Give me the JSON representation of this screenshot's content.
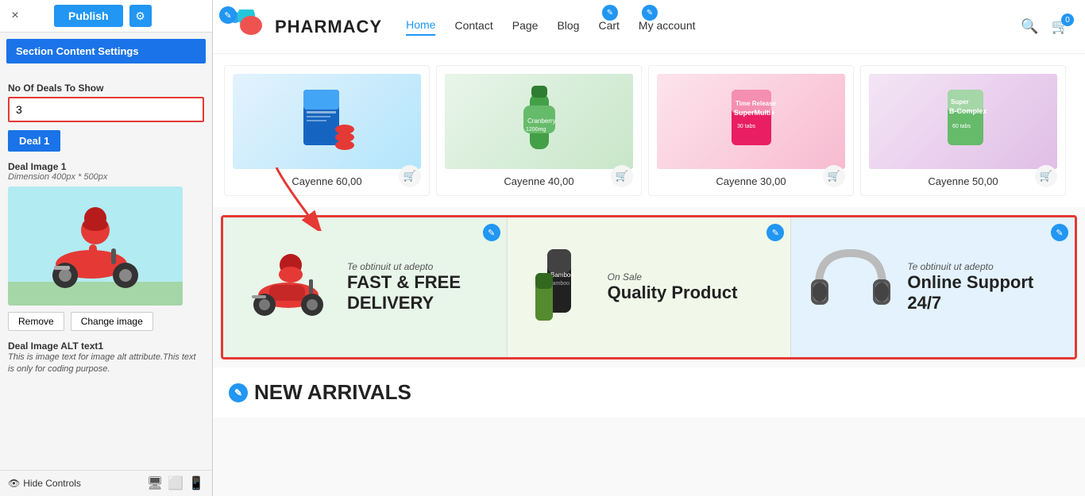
{
  "leftPanel": {
    "closeLabel": "×",
    "publishLabel": "Publish",
    "gearLabel": "⚙",
    "sectionSettingsLabel": "Section Content Settings",
    "noDealsLabel": "No Of Deals To Show",
    "noDealsValue": "3",
    "dealBtnLabel": "Deal 1",
    "dealImageLabel": "Deal Image 1",
    "dealImageDim": "Dimension 400px * 500px",
    "removeLabel": "Remove",
    "changeImageLabel": "Change image",
    "altTextLabel": "Deal Image ALT text1",
    "altTextDesc": "This is image text for image alt attribute.This text is only for coding purpose.",
    "hideControlsLabel": "Hide Controls",
    "deviceDesktopIcon": "🖥",
    "deviceTabletIcon": "⬜",
    "deviceMobileIcon": "📱"
  },
  "topNav": {
    "logoText": "PHARMACY",
    "links": [
      "Home",
      "Contact",
      "Page",
      "Blog",
      "Cart",
      "My account"
    ],
    "activeLink": "Home",
    "cartCount": "0"
  },
  "products": [
    {
      "name": "Cayenne 60,00",
      "emoji": "💊"
    },
    {
      "name": "Cayenne 40,00",
      "emoji": "🧴"
    },
    {
      "name": "Cayenne 30,00",
      "emoji": "💊"
    },
    {
      "name": "Cayenne 50,00",
      "emoji": "🧴"
    }
  ],
  "deals": [
    {
      "smallText": "Te obtinuit ut adepto",
      "mainText": "FAST & FREE DELIVERY",
      "emoji": "🛵",
      "bg": "#e8f5e9"
    },
    {
      "smallText": "On Sale",
      "mainText": "Quality Product",
      "emoji": "🧴",
      "bg": "#f1f8e9"
    },
    {
      "smallText": "Te obtinuit ut adepto",
      "mainText": "Online Support 24/7",
      "emoji": "🎧",
      "bg": "#e3f2fd"
    }
  ],
  "newArrivals": {
    "title": "NEW ARRIVALS"
  },
  "icons": {
    "pencil": "✎",
    "cart": "🛒",
    "search": "🔍",
    "gear": "⚙",
    "close": "×",
    "eyeOff": "👁",
    "desktop": "🖥",
    "tablet": "⬜",
    "mobile": "📱",
    "chevronDown": "▼"
  },
  "colors": {
    "blue": "#2196F3",
    "red": "#e53935",
    "green1": "#e8f5e9",
    "green2": "#f1f8e9",
    "lightBlue": "#e3f2fd"
  }
}
